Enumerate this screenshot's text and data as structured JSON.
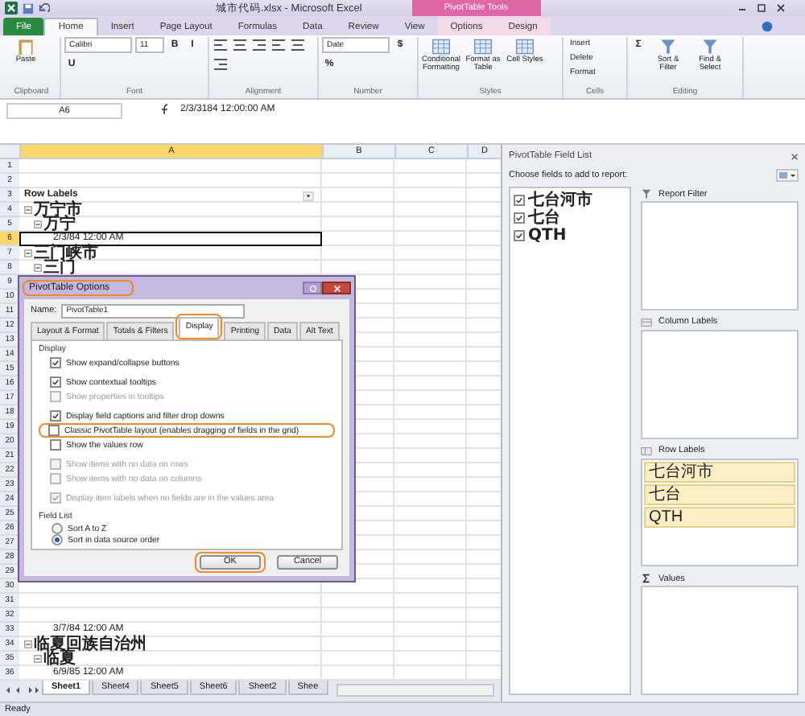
{
  "window": {
    "title": "城市代码.xlsx - Microsoft Excel",
    "context_group": "PivotTable Tools"
  },
  "ribbon_tabs": [
    {
      "label": "File",
      "selected": false
    },
    {
      "label": "Home",
      "selected": true
    },
    {
      "label": "Insert",
      "selected": false
    },
    {
      "label": "Page Layout",
      "selected": false
    },
    {
      "label": "Formulas",
      "selected": false
    },
    {
      "label": "Data",
      "selected": false
    },
    {
      "label": "Review",
      "selected": false
    },
    {
      "label": "View",
      "selected": false
    },
    {
      "label": "Options",
      "selected": false
    },
    {
      "label": "Design",
      "selected": false
    }
  ],
  "ribbon_groups": [
    {
      "kind": "clipboard",
      "label": "Clipboard",
      "buttons": [
        {
          "kind": "large",
          "label": "Paste"
        }
      ]
    },
    {
      "kind": "font",
      "label": "Font",
      "buttons": [
        {
          "kind": "field",
          "label": "Calibri"
        },
        {
          "kind": "field",
          "label": "11"
        },
        {
          "kind": "glyph",
          "label": "B"
        },
        {
          "kind": "glyph",
          "label": "I"
        },
        {
          "kind": "glyph",
          "label": "U"
        }
      ]
    },
    {
      "kind": "alignment",
      "label": "Alignment"
    },
    {
      "kind": "number",
      "label": "Number",
      "buttons": [
        {
          "kind": "field",
          "label": "Date"
        },
        {
          "kind": "glyph",
          "label": "$"
        },
        {
          "kind": "glyph",
          "label": "%"
        }
      ]
    },
    {
      "kind": "styles",
      "label": "Styles",
      "buttons": [
        {
          "kind": "large",
          "label": "Conditional Formatting"
        },
        {
          "kind": "large",
          "label": "Format as Table"
        },
        {
          "kind": "large",
          "label": "Cell Styles"
        }
      ]
    },
    {
      "kind": "cells",
      "label": "Cells",
      "buttons": [
        {
          "kind": "small",
          "label": "Insert"
        },
        {
          "kind": "small",
          "label": "Delete"
        },
        {
          "kind": "small",
          "label": "Format"
        }
      ]
    },
    {
      "kind": "editing",
      "label": "Editing",
      "buttons": [
        {
          "kind": "glyph",
          "label": "Σ"
        },
        {
          "kind": "large",
          "label": "Sort & Filter"
        },
        {
          "kind": "large",
          "label": "Find & Select"
        }
      ]
    }
  ],
  "formula_bar": {
    "name_box": "A6",
    "value": "2/3/3184 12:00:00 AM"
  },
  "columns": [
    {
      "label": "A",
      "selected": true
    },
    {
      "label": "B",
      "selected": false
    },
    {
      "label": "C",
      "selected": false
    },
    {
      "label": "D",
      "selected": false
    }
  ],
  "rows": [
    {
      "number": "1",
      "selected": false
    },
    {
      "number": "2",
      "selected": false
    },
    {
      "number": "3",
      "kind": "header",
      "label": "Row Labels",
      "selected": false
    },
    {
      "number": "4",
      "kind": "group",
      "label": "万宁市",
      "selected": false
    },
    {
      "number": "5",
      "kind": "subgroup",
      "label": "万宁",
      "selected": false
    },
    {
      "number": "6",
      "kind": "item",
      "label": "2/3/84 12:00 AM",
      "selected": true
    },
    {
      "number": "7",
      "kind": "group",
      "label": "三门峡市",
      "selected": false
    },
    {
      "number": "8",
      "kind": "subgroup",
      "label": "三门",
      "selected": false
    },
    {
      "number": "9",
      "selected": false
    },
    {
      "number": "10",
      "selected": false
    },
    {
      "number": "11",
      "selected": false
    },
    {
      "number": "12",
      "selected": false
    },
    {
      "number": "13",
      "selected": false
    },
    {
      "number": "14",
      "selected": false
    },
    {
      "number": "15",
      "selected": false
    },
    {
      "number": "16",
      "selected": false
    },
    {
      "number": "17",
      "selected": false
    },
    {
      "number": "18",
      "selected": false
    },
    {
      "number": "19",
      "selected": false
    },
    {
      "number": "20",
      "selected": false
    },
    {
      "number": "21",
      "selected": false
    },
    {
      "number": "22",
      "selected": false
    },
    {
      "number": "23",
      "selected": false
    },
    {
      "number": "24",
      "selected": false
    },
    {
      "number": "25",
      "selected": false
    },
    {
      "number": "26",
      "selected": false
    },
    {
      "number": "27",
      "selected": false
    },
    {
      "number": "28",
      "selected": false
    },
    {
      "number": "29",
      "selected": false
    },
    {
      "number": "30",
      "selected": false
    },
    {
      "number": "31",
      "selected": false
    },
    {
      "number": "32",
      "selected": false
    },
    {
      "number": "33",
      "kind": "item",
      "label": "3/7/84 12:00 AM",
      "selected": false
    },
    {
      "number": "34",
      "kind": "group",
      "label": "临夏回族自治州",
      "selected": false
    },
    {
      "number": "35",
      "kind": "subgroup",
      "label": "临夏",
      "selected": false
    },
    {
      "number": "36",
      "kind": "item",
      "label": "6/9/85 12:00 AM",
      "selected": false
    }
  ],
  "sheet_tabs": [
    {
      "label": "Sheet1",
      "selected": true
    },
    {
      "label": "Sheet4",
      "selected": false
    },
    {
      "label": "Sheet5",
      "selected": false
    },
    {
      "label": "Sheet6",
      "selected": false
    },
    {
      "label": "Sheet2",
      "selected": false
    },
    {
      "label": "Shee",
      "selected": false
    }
  ],
  "status_bar": "Ready",
  "field_list": {
    "title": "PivotTable Field List",
    "prompt": "Choose fields to add to report:",
    "fields": [
      {
        "label": "七台河市",
        "checked": true
      },
      {
        "label": "七台",
        "checked": true
      },
      {
        "label": "QTH",
        "checked": true
      }
    ],
    "areas": [
      {
        "kind": "filter",
        "label": "Report Filter"
      },
      {
        "kind": "columns",
        "label": "Column Labels"
      },
      {
        "kind": "rows",
        "label": "Row Labels",
        "items": [
          "七台河市",
          "七台",
          "QTH"
        ]
      },
      {
        "kind": "values",
        "label": "Values"
      }
    ]
  },
  "dialog": {
    "title": "PivotTable Options",
    "title_highlighted": true,
    "name_label": "Name:",
    "name_value": "PivotTable1",
    "tabs": [
      {
        "label": "Layout & Format",
        "selected": false,
        "highlighted": false
      },
      {
        "label": "Totals & Filters",
        "selected": false,
        "highlighted": false
      },
      {
        "label": "Display",
        "selected": true,
        "highlighted": true
      },
      {
        "label": "Printing",
        "selected": false,
        "highlighted": false
      },
      {
        "label": "Data",
        "selected": false,
        "highlighted": false
      },
      {
        "label": "Alt Text",
        "selected": false,
        "highlighted": false
      }
    ],
    "section": "Display",
    "option_groups": [
      {
        "options": [
          {
            "label": "Show expand/collapse buttons",
            "checked": true,
            "disabled": false,
            "highlighted": false
          }
        ]
      },
      {
        "options": [
          {
            "label": "Show contextual tooltips",
            "checked": true,
            "disabled": false,
            "highlighted": false
          },
          {
            "label": "Show properties in tooltips",
            "checked": false,
            "disabled": true,
            "highlighted": false
          }
        ]
      },
      {
        "options": [
          {
            "label": "Display field captions and filter drop downs",
            "checked": true,
            "disabled": false,
            "highlighted": false
          },
          {
            "label": "Classic PivotTable layout (enables dragging of fields in the grid)",
            "checked": false,
            "disabled": false,
            "highlighted": true
          },
          {
            "label": "Show the values row",
            "checked": false,
            "disabled": false,
            "highlighted": false
          }
        ]
      },
      {
        "options": [
          {
            "label": "Show items with no data on rows",
            "checked": false,
            "disabled": true,
            "highlighted": false
          },
          {
            "label": "Show items with no data on columns",
            "checked": false,
            "disabled": true,
            "highlighted": false
          }
        ]
      },
      {
        "options": [
          {
            "label": "Display item labels when no fields are in the values area",
            "checked": true,
            "disabled": true,
            "highlighted": false
          }
        ]
      }
    ],
    "sort_section": "Field List",
    "sort_options": [
      {
        "label": "Sort A to Z",
        "selected": false
      },
      {
        "label": "Sort in data source order",
        "selected": true
      }
    ],
    "buttons": [
      {
        "label": "OK",
        "highlighted": true
      },
      {
        "label": "Cancel",
        "highlighted": false
      }
    ]
  }
}
